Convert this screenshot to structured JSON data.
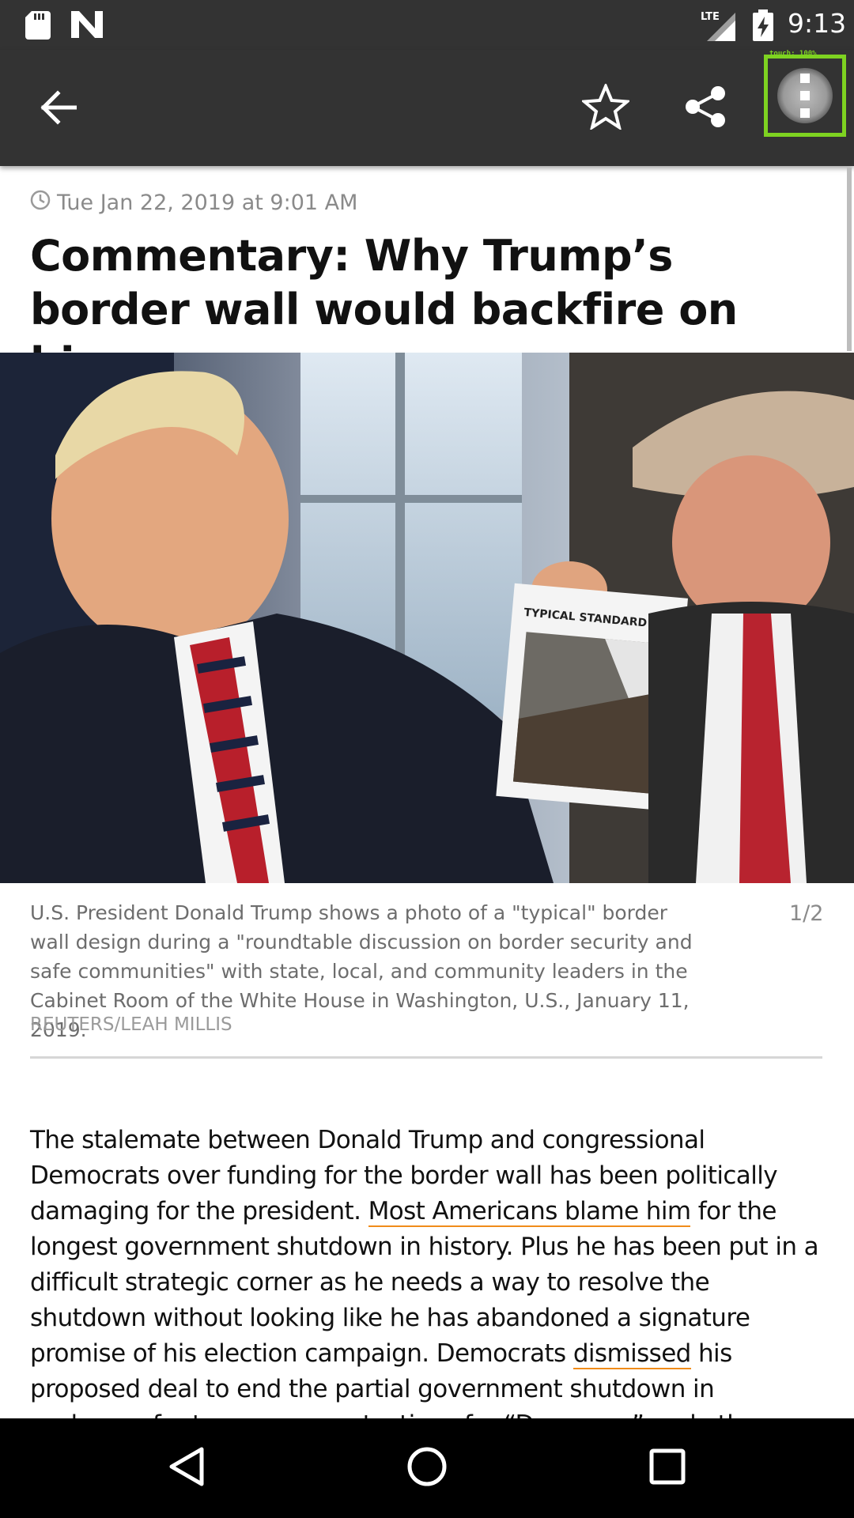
{
  "status_bar": {
    "time": "9:13",
    "network_label": "LTE",
    "icons": [
      "sd-card-icon",
      "n-app-icon",
      "lte-signal-icon",
      "battery-charging-icon"
    ]
  },
  "app_bar": {
    "icons": [
      "back-arrow-icon",
      "star-outline-icon",
      "share-icon",
      "more-vert-icon"
    ],
    "touch_overlay": "touch: 100%",
    "highlight_color": "#7ed321"
  },
  "article": {
    "date": "Tue Jan 22, 2019 at 9:01 AM",
    "headline": "Commentary: Why Trump’s border wall would backfire on him",
    "photo": {
      "sign_text": "TYPICAL STANDARD WALL DESIGN",
      "counter": "1/2",
      "caption": "U.S. President Donald Trump shows a photo of a \"typical\" border wall design  during a \"roundtable discussion on border security and safe communities\" with state, local, and community leaders in the Cabinet Room of the White House in Washington, U.S., January 11, 2019.",
      "credit": "REUTERS/LEAH MILLIS"
    },
    "body": {
      "p1": "The stalemate between Donald Trump and congressional Democrats over funding for the border wall has been politically damaging for the president. ",
      "link1": "Most Americans blame him",
      "p2": " for the longest government shutdown in history. Plus he has been put in a difficult strategic corner as he needs a way to resolve the shutdown without looking like he has abandoned a signature promise of his election campaign. Democrats ",
      "link2": "dismissed",
      "p3": " his proposed deal to end the partial government shutdown in exchange for temporary protections for “Dreamers” and other immigrants."
    },
    "link_underline_color": "#f08c1a"
  },
  "nav_bar": {
    "icons": [
      "nav-back-icon",
      "nav-home-icon",
      "nav-recents-icon"
    ]
  }
}
